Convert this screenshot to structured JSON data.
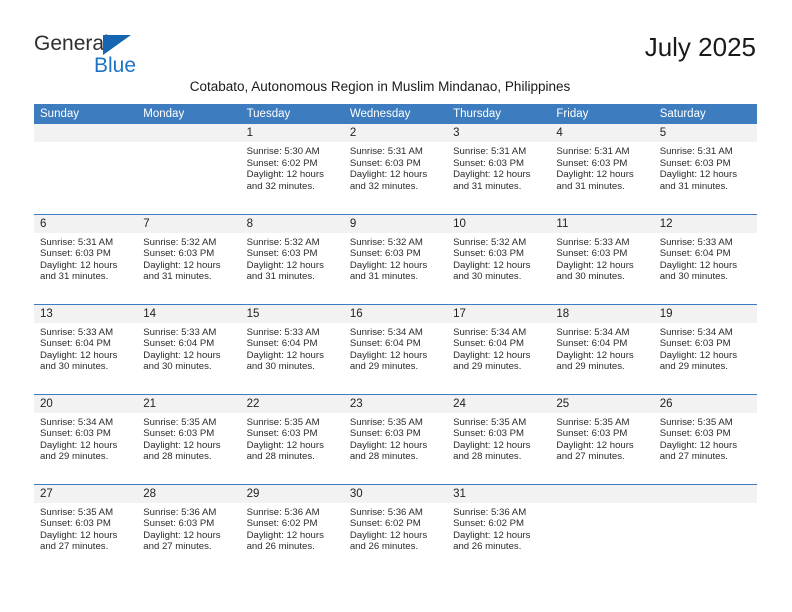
{
  "brand": {
    "word1": "General",
    "word2": "Blue",
    "triangle_icon": "triangle-icon",
    "accent_color": "#1f74c4"
  },
  "header": {
    "month_title": "July 2025",
    "location": "Cotabato, Autonomous Region in Muslim Mindanao, Philippines"
  },
  "calendar": {
    "header_bg": "#3d7dbf",
    "date_band_bg": "#f2f2f2",
    "weekdays": [
      "Sunday",
      "Monday",
      "Tuesday",
      "Wednesday",
      "Thursday",
      "Friday",
      "Saturday"
    ],
    "weeks": [
      [
        {
          "date": "",
          "empty": true
        },
        {
          "date": "",
          "empty": true
        },
        {
          "date": "1",
          "sunrise": "Sunrise: 5:30 AM",
          "sunset": "Sunset: 6:02 PM",
          "daylight1": "Daylight: 12 hours",
          "daylight2": "and 32 minutes."
        },
        {
          "date": "2",
          "sunrise": "Sunrise: 5:31 AM",
          "sunset": "Sunset: 6:03 PM",
          "daylight1": "Daylight: 12 hours",
          "daylight2": "and 32 minutes."
        },
        {
          "date": "3",
          "sunrise": "Sunrise: 5:31 AM",
          "sunset": "Sunset: 6:03 PM",
          "daylight1": "Daylight: 12 hours",
          "daylight2": "and 31 minutes."
        },
        {
          "date": "4",
          "sunrise": "Sunrise: 5:31 AM",
          "sunset": "Sunset: 6:03 PM",
          "daylight1": "Daylight: 12 hours",
          "daylight2": "and 31 minutes."
        },
        {
          "date": "5",
          "sunrise": "Sunrise: 5:31 AM",
          "sunset": "Sunset: 6:03 PM",
          "daylight1": "Daylight: 12 hours",
          "daylight2": "and 31 minutes."
        }
      ],
      [
        {
          "date": "6",
          "sunrise": "Sunrise: 5:31 AM",
          "sunset": "Sunset: 6:03 PM",
          "daylight1": "Daylight: 12 hours",
          "daylight2": "and 31 minutes."
        },
        {
          "date": "7",
          "sunrise": "Sunrise: 5:32 AM",
          "sunset": "Sunset: 6:03 PM",
          "daylight1": "Daylight: 12 hours",
          "daylight2": "and 31 minutes."
        },
        {
          "date": "8",
          "sunrise": "Sunrise: 5:32 AM",
          "sunset": "Sunset: 6:03 PM",
          "daylight1": "Daylight: 12 hours",
          "daylight2": "and 31 minutes."
        },
        {
          "date": "9",
          "sunrise": "Sunrise: 5:32 AM",
          "sunset": "Sunset: 6:03 PM",
          "daylight1": "Daylight: 12 hours",
          "daylight2": "and 31 minutes."
        },
        {
          "date": "10",
          "sunrise": "Sunrise: 5:32 AM",
          "sunset": "Sunset: 6:03 PM",
          "daylight1": "Daylight: 12 hours",
          "daylight2": "and 30 minutes."
        },
        {
          "date": "11",
          "sunrise": "Sunrise: 5:33 AM",
          "sunset": "Sunset: 6:03 PM",
          "daylight1": "Daylight: 12 hours",
          "daylight2": "and 30 minutes."
        },
        {
          "date": "12",
          "sunrise": "Sunrise: 5:33 AM",
          "sunset": "Sunset: 6:04 PM",
          "daylight1": "Daylight: 12 hours",
          "daylight2": "and 30 minutes."
        }
      ],
      [
        {
          "date": "13",
          "sunrise": "Sunrise: 5:33 AM",
          "sunset": "Sunset: 6:04 PM",
          "daylight1": "Daylight: 12 hours",
          "daylight2": "and 30 minutes."
        },
        {
          "date": "14",
          "sunrise": "Sunrise: 5:33 AM",
          "sunset": "Sunset: 6:04 PM",
          "daylight1": "Daylight: 12 hours",
          "daylight2": "and 30 minutes."
        },
        {
          "date": "15",
          "sunrise": "Sunrise: 5:33 AM",
          "sunset": "Sunset: 6:04 PM",
          "daylight1": "Daylight: 12 hours",
          "daylight2": "and 30 minutes."
        },
        {
          "date": "16",
          "sunrise": "Sunrise: 5:34 AM",
          "sunset": "Sunset: 6:04 PM",
          "daylight1": "Daylight: 12 hours",
          "daylight2": "and 29 minutes."
        },
        {
          "date": "17",
          "sunrise": "Sunrise: 5:34 AM",
          "sunset": "Sunset: 6:04 PM",
          "daylight1": "Daylight: 12 hours",
          "daylight2": "and 29 minutes."
        },
        {
          "date": "18",
          "sunrise": "Sunrise: 5:34 AM",
          "sunset": "Sunset: 6:04 PM",
          "daylight1": "Daylight: 12 hours",
          "daylight2": "and 29 minutes."
        },
        {
          "date": "19",
          "sunrise": "Sunrise: 5:34 AM",
          "sunset": "Sunset: 6:03 PM",
          "daylight1": "Daylight: 12 hours",
          "daylight2": "and 29 minutes."
        }
      ],
      [
        {
          "date": "20",
          "sunrise": "Sunrise: 5:34 AM",
          "sunset": "Sunset: 6:03 PM",
          "daylight1": "Daylight: 12 hours",
          "daylight2": "and 29 minutes."
        },
        {
          "date": "21",
          "sunrise": "Sunrise: 5:35 AM",
          "sunset": "Sunset: 6:03 PM",
          "daylight1": "Daylight: 12 hours",
          "daylight2": "and 28 minutes."
        },
        {
          "date": "22",
          "sunrise": "Sunrise: 5:35 AM",
          "sunset": "Sunset: 6:03 PM",
          "daylight1": "Daylight: 12 hours",
          "daylight2": "and 28 minutes."
        },
        {
          "date": "23",
          "sunrise": "Sunrise: 5:35 AM",
          "sunset": "Sunset: 6:03 PM",
          "daylight1": "Daylight: 12 hours",
          "daylight2": "and 28 minutes."
        },
        {
          "date": "24",
          "sunrise": "Sunrise: 5:35 AM",
          "sunset": "Sunset: 6:03 PM",
          "daylight1": "Daylight: 12 hours",
          "daylight2": "and 28 minutes."
        },
        {
          "date": "25",
          "sunrise": "Sunrise: 5:35 AM",
          "sunset": "Sunset: 6:03 PM",
          "daylight1": "Daylight: 12 hours",
          "daylight2": "and 27 minutes."
        },
        {
          "date": "26",
          "sunrise": "Sunrise: 5:35 AM",
          "sunset": "Sunset: 6:03 PM",
          "daylight1": "Daylight: 12 hours",
          "daylight2": "and 27 minutes."
        }
      ],
      [
        {
          "date": "27",
          "sunrise": "Sunrise: 5:35 AM",
          "sunset": "Sunset: 6:03 PM",
          "daylight1": "Daylight: 12 hours",
          "daylight2": "and 27 minutes."
        },
        {
          "date": "28",
          "sunrise": "Sunrise: 5:36 AM",
          "sunset": "Sunset: 6:03 PM",
          "daylight1": "Daylight: 12 hours",
          "daylight2": "and 27 minutes."
        },
        {
          "date": "29",
          "sunrise": "Sunrise: 5:36 AM",
          "sunset": "Sunset: 6:02 PM",
          "daylight1": "Daylight: 12 hours",
          "daylight2": "and 26 minutes."
        },
        {
          "date": "30",
          "sunrise": "Sunrise: 5:36 AM",
          "sunset": "Sunset: 6:02 PM",
          "daylight1": "Daylight: 12 hours",
          "daylight2": "and 26 minutes."
        },
        {
          "date": "31",
          "sunrise": "Sunrise: 5:36 AM",
          "sunset": "Sunset: 6:02 PM",
          "daylight1": "Daylight: 12 hours",
          "daylight2": "and 26 minutes."
        },
        {
          "date": "",
          "empty": true
        },
        {
          "date": "",
          "empty": true
        }
      ]
    ]
  }
}
